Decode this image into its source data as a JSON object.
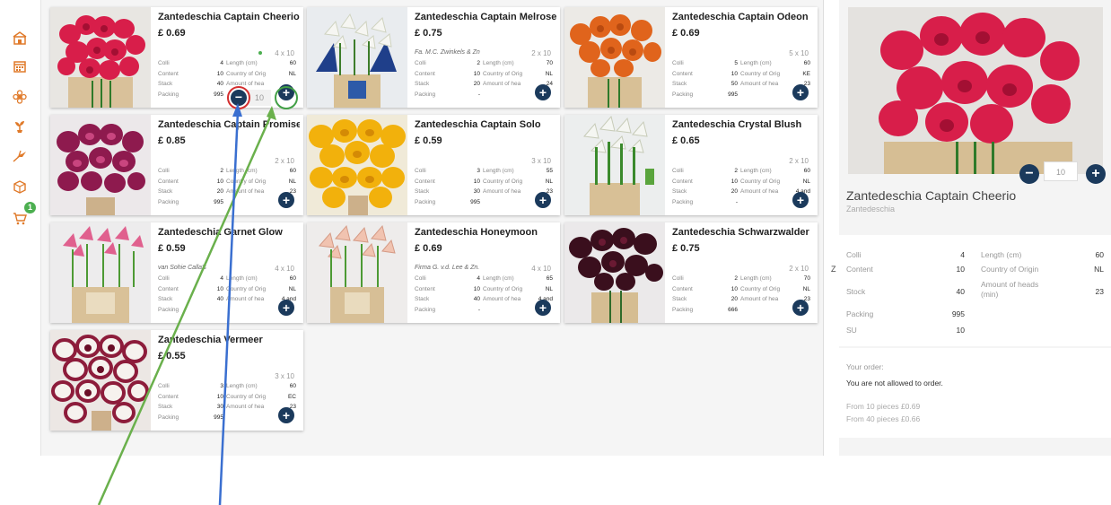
{
  "colors": {
    "accent": "#1b3a5c",
    "icon": "#e07a2a",
    "badge": "#4caf50",
    "ring_red": "#d32f2f",
    "ring_green": "#43a047",
    "arrow_green": "#6ab04c",
    "arrow_blue": "#3a6fd0"
  },
  "sidebar": {
    "icons": [
      "store-icon",
      "calendar-icon",
      "flower-icon",
      "plant-icon",
      "bird-of-paradise-icon",
      "box-icon",
      "cart-icon"
    ],
    "cart_badge": "1"
  },
  "products": [
    {
      "name": "Zantedeschia Captain Cheerio",
      "price": "£ 0.69",
      "grower": "",
      "pack": "4 x 10",
      "colli": "4",
      "length": "60",
      "content": "10",
      "origin": "NL",
      "stock": "40",
      "heads": "",
      "packing": "995",
      "qty": "10",
      "l1": "Colli",
      "l2": "Length (cm)",
      "l3": "Content",
      "l4": "Country of Orig",
      "l5": "Stack",
      "l6": "Amount of hea",
      "l7": "Packing"
    },
    {
      "name": "Zantedeschia Captain Melrose",
      "price": "£ 0.75",
      "grower": "Fa. M.C. Zwinkels & Zn",
      "pack": "2 x 10",
      "colli": "2",
      "length": "70",
      "content": "10",
      "origin": "NL",
      "stock": "20",
      "heads": "24",
      "packing": "-",
      "l1": "Colli",
      "l2": "Length (cm)",
      "l3": "Content",
      "l4": "Country of Orig",
      "l5": "Stack",
      "l6": "Amount of hea",
      "l7": "Packing"
    },
    {
      "name": "Zantedeschia Captain Odeon",
      "price": "£ 0.69",
      "grower": "",
      "pack": "5 x 10",
      "colli": "5",
      "length": "60",
      "content": "10",
      "origin": "KE",
      "stock": "50",
      "heads": "23",
      "packing": "995",
      "l1": "Colli",
      "l2": "Length (cm)",
      "l3": "Content",
      "l4": "Country of Orig",
      "l5": "Stack",
      "l6": "Amount of hea",
      "l7": "Packing"
    },
    {
      "name": "Zantedeschia Captain Promise",
      "price": "£ 0.85",
      "grower": "",
      "pack": "2 x 10",
      "colli": "2",
      "length": "60",
      "content": "10",
      "origin": "NL",
      "stock": "20",
      "heads": "23",
      "packing": "995",
      "l1": "Colli",
      "l2": "Length (cm)",
      "l3": "Content",
      "l4": "Country of Orig",
      "l5": "Stack",
      "l6": "Amount of hea",
      "l7": "Packing"
    },
    {
      "name": "Zantedeschia Captain Solo",
      "price": "£ 0.59",
      "grower": "",
      "pack": "3 x 10",
      "colli": "3",
      "length": "55",
      "content": "10",
      "origin": "NL",
      "stock": "30",
      "heads": "23",
      "packing": "995",
      "l1": "Colli",
      "l2": "Length (cm)",
      "l3": "Content",
      "l4": "Country of Orig",
      "l5": "Stack",
      "l6": "Amount of hea",
      "l7": "Packing"
    },
    {
      "name": "Zantedeschia Crystal Blush",
      "price": "£ 0.65",
      "grower": "",
      "pack": "2 x 10",
      "colli": "2",
      "length": "60",
      "content": "10",
      "origin": "NL",
      "stock": "20",
      "heads": "4 and",
      "packing": "-",
      "l1": "Colli",
      "l2": "Length (cm)",
      "l3": "Content",
      "l4": "Country of Orig",
      "l5": "Stack",
      "l6": "Amount of hea",
      "l7": "Packing"
    },
    {
      "name": "Zantedeschia Garnet Glow",
      "price": "£ 0.59",
      "grower": "van Sohie Calla's",
      "pack": "4 x 10",
      "colli": "4",
      "length": "60",
      "content": "10",
      "origin": "NL",
      "stock": "40",
      "heads": "4 and",
      "packing": "",
      "l1": "Colli",
      "l2": "Length (cm)",
      "l3": "Content",
      "l4": "Country of Orig",
      "l5": "Stack",
      "l6": "Amount of hea",
      "l7": "Packing"
    },
    {
      "name": "Zantedeschia Honeymoon",
      "price": "£ 0.69",
      "grower": "Firma G. v.d. Lee & Zn.",
      "pack": "4 x 10",
      "colli": "4",
      "length": "65",
      "content": "10",
      "origin": "NL",
      "stock": "40",
      "heads": "4 and",
      "packing": "-",
      "l1": "Colli",
      "l2": "Length (cm)",
      "l3": "Content",
      "l4": "Country of Orig",
      "l5": "Stack",
      "l6": "Amount of hea",
      "l7": "Packing"
    },
    {
      "name": "Zantedeschia Schwarzwalder",
      "price": "£ 0.75",
      "grower": "",
      "pack": "2 x 10",
      "colli": "2",
      "length": "70",
      "content": "10",
      "origin": "NL",
      "stock": "20",
      "heads": "23",
      "packing": "666",
      "l1": "Colli",
      "l2": "Length (cm)",
      "l3": "Content",
      "l4": "Country of Orig",
      "l5": "Stack",
      "l6": "Amount of hea",
      "l7": "Packing"
    },
    {
      "name": "Zantedeschia Vermeer",
      "price": "£ 0.55",
      "grower": "",
      "pack": "3 x 10",
      "colli": "3",
      "length": "60",
      "content": "10",
      "origin": "EC",
      "stock": "30",
      "heads": "23",
      "packing": "995",
      "l1": "Colli",
      "l2": "Length (cm)",
      "l3": "Content",
      "l4": "Country of Orig",
      "l5": "Stack",
      "l6": "Amount of hea",
      "l7": "Packing"
    }
  ],
  "detail": {
    "qty": "10",
    "name": "Zantedeschia Captain Cheerio",
    "subtitle": "Zantedeschia",
    "side_letter": "Z",
    "colli_label": "Colli",
    "colli": "4",
    "length_label": "Length (cm)",
    "length": "60",
    "content_label": "Content",
    "content": "10",
    "origin_label": "Country of Origin",
    "origin": "NL",
    "stock_label": "Stock",
    "stock": "40",
    "heads_label": "Amount of heads (min)",
    "heads": "23",
    "packing_label": "Packing",
    "packing": "995",
    "su_label": "SU",
    "su": "10",
    "order_label": "Your order:",
    "order_msg": "You are not allowed to order.",
    "tier1": "From 10 pieces £0.69",
    "tier2": "From 40 pieces £0.66"
  },
  "add_label": "+",
  "minus_label": "−"
}
